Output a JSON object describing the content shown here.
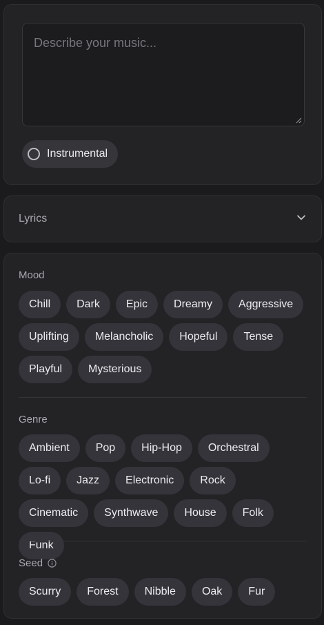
{
  "prompt": {
    "placeholder": "Describe your music...",
    "instrumental_label": "Instrumental"
  },
  "lyrics": {
    "label": "Lyrics"
  },
  "mood": {
    "label": "Mood",
    "tags": [
      "Chill",
      "Dark",
      "Epic",
      "Dreamy",
      "Aggressive",
      "Uplifting",
      "Melancholic",
      "Hopeful",
      "Tense",
      "Playful",
      "Mysterious"
    ]
  },
  "genre": {
    "label": "Genre",
    "tags": [
      "Ambient",
      "Pop",
      "Hip-Hop",
      "Orchestral",
      "Lo-fi",
      "Jazz",
      "Electronic",
      "Rock",
      "Cinematic",
      "Synthwave",
      "House",
      "Folk",
      "Funk"
    ]
  },
  "seed": {
    "label": "Seed",
    "tags": [
      "Scurry",
      "Forest",
      "Nibble",
      "Oak",
      "Fur"
    ]
  },
  "icons": {
    "radio": "radio-unchecked-icon",
    "chevron": "chevron-down-icon",
    "info": "info-icon",
    "resize": "resize-grip-icon"
  }
}
